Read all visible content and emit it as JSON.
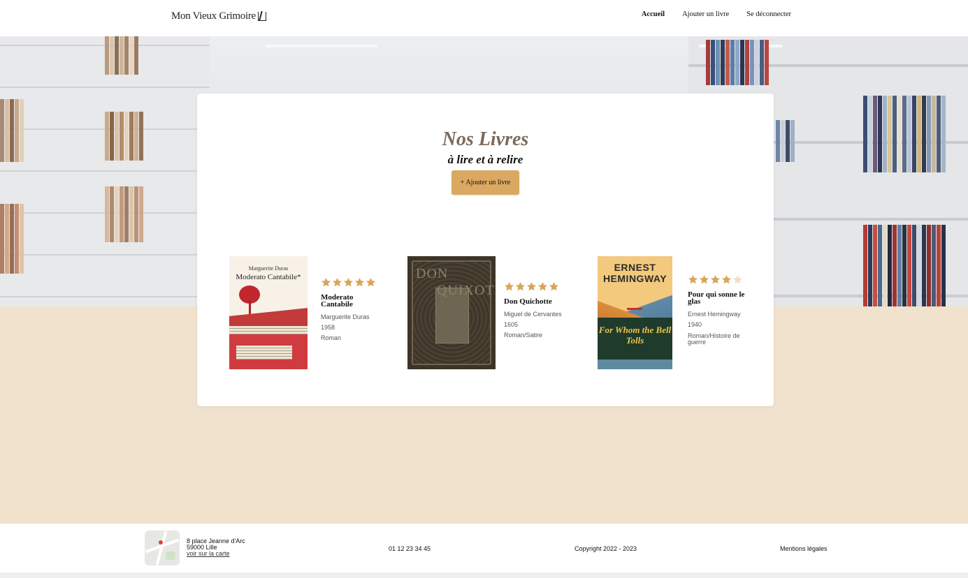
{
  "header": {
    "logo_text": "Mon Vieux Grimoire",
    "nav": [
      {
        "label": "Accueil",
        "active": true
      },
      {
        "label": "Ajouter un livre",
        "active": false
      },
      {
        "label": "Se déconnecter",
        "active": false
      }
    ]
  },
  "main": {
    "title": "Nos Livres",
    "subtitle": "à lire et à relire",
    "add_button": "+ Ajouter un livre",
    "books": [
      {
        "title": "Moderato Cantabile",
        "author": "Marguerite Duras",
        "year": "1958",
        "genre": "Roman",
        "rating": 5,
        "cover": {
          "author": "Marguerite Duras",
          "title": "Moderato Cantabile*"
        }
      },
      {
        "title": "Don Quichotte",
        "author": "Miguel de Cervantes",
        "year": "1605",
        "genre": "Roman/Satire",
        "rating": 5,
        "cover": {
          "line1": "DON",
          "line2": "QUIXOTE"
        }
      },
      {
        "title": "Pour qui sonne le glas",
        "author": "Ernest Hemingway",
        "year": "1940",
        "genre": "Roman/Histoire de guerre",
        "rating": 4,
        "cover": {
          "author": "ERNEST HEMINGWAY",
          "title": "For Whom the Bell Tolls"
        }
      }
    ],
    "star_colors": {
      "filled": "#d8a55a",
      "empty": "#f1dfc3"
    }
  },
  "footer": {
    "address_line1": "8 place Jeanne d'Arc",
    "address_line2": "59000 Lille",
    "map_link": "voir sur la carte",
    "phone": "01 12 23 34 45",
    "copyright": "Copyright 2022 - 2023",
    "legal": "Mentions légales"
  },
  "colors": {
    "accent": "#dba862",
    "page_background": "#f0e2cc",
    "title_color": "#7b6a5c"
  }
}
